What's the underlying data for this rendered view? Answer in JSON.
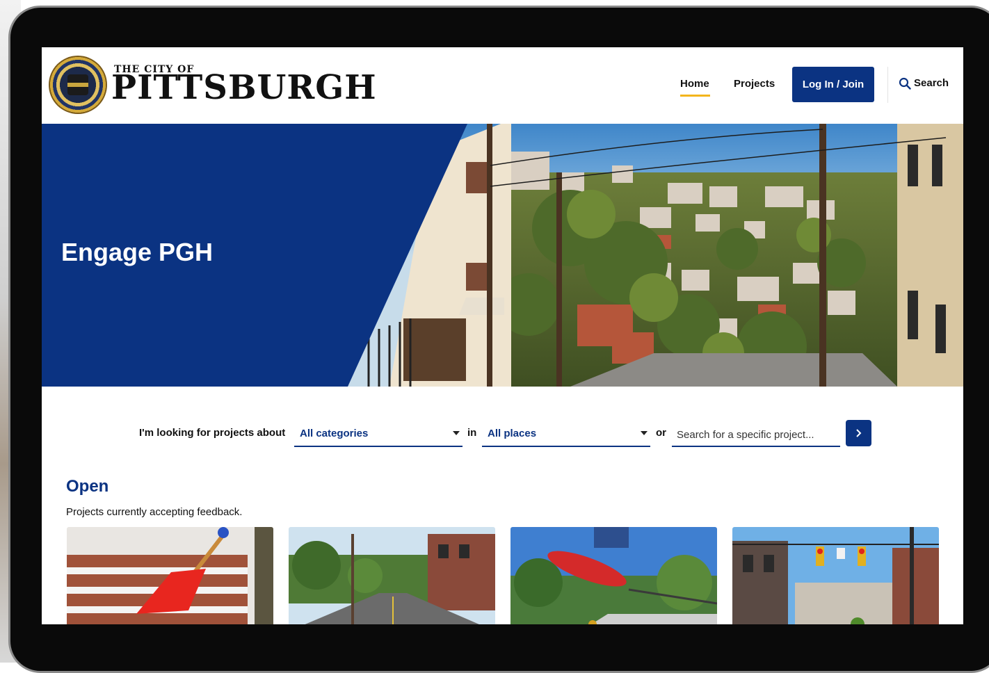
{
  "header": {
    "logo_top": "THE CITY OF",
    "logo_main": "PITTSBURGH",
    "nav": {
      "home": "Home",
      "projects": "Projects",
      "login": "Log In / Join",
      "search": "Search"
    }
  },
  "hero": {
    "title": "Engage PGH"
  },
  "filter": {
    "label": "I'm looking for projects about",
    "category_value": "All categories",
    "in_word": "in",
    "place_value": "All places",
    "or_word": "or",
    "search_placeholder": "Search for a specific project..."
  },
  "open_section": {
    "title": "Open",
    "subtitle": "Projects currently accepting feedback.",
    "cards": [
      "snow-shovel-steps-photo",
      "residential-street-photo",
      "skateboarder-photo",
      "traffic-signals-photo"
    ]
  },
  "colors": {
    "brand_blue": "#0b3382",
    "accent_yellow": "#f3b51c"
  }
}
